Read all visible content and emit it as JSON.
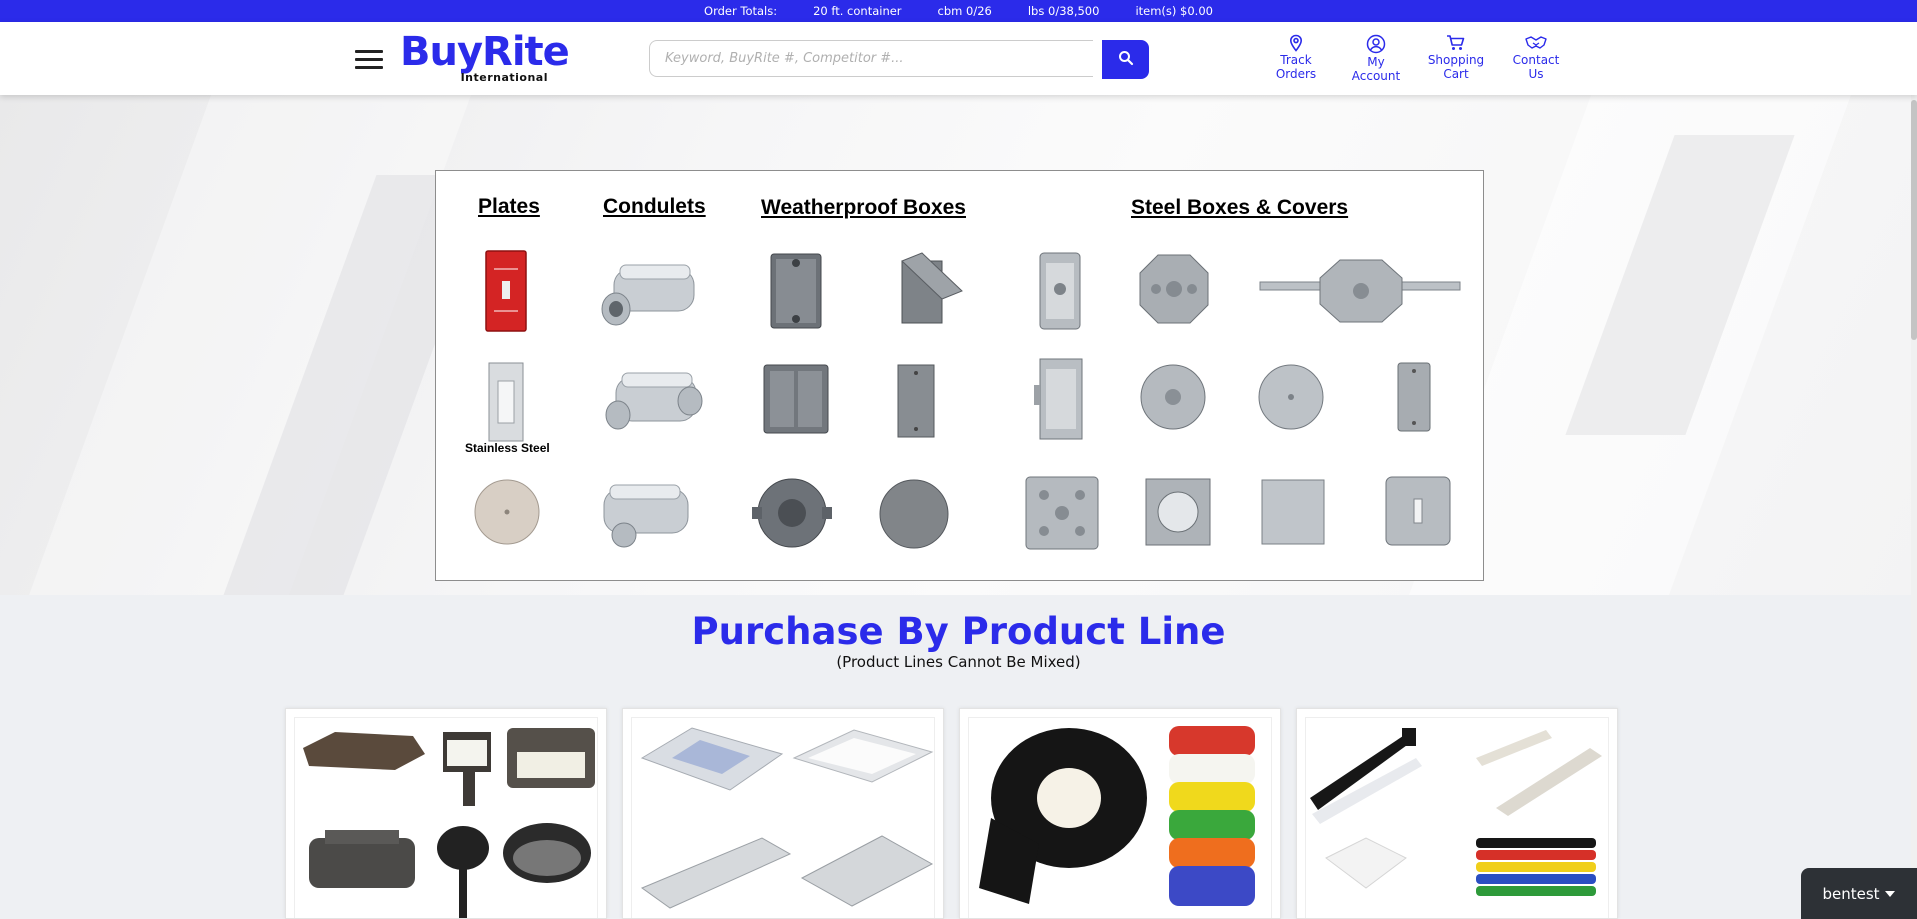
{
  "topbar": {
    "order_totals": "Order Totals:",
    "container": "20 ft. container",
    "cbm": "cbm 0/26",
    "lbs": "lbs 0/38,500",
    "items": "item(s) $0.00"
  },
  "header": {
    "logo_brand": "BuyRite",
    "logo_sub": "International",
    "search_placeholder": "Keyword, BuyRite #, Competitor #...",
    "nav": {
      "track": [
        "Track",
        "Orders"
      ],
      "account": [
        "My",
        "Account"
      ],
      "cart": [
        "Shopping",
        "Cart"
      ],
      "contact": [
        "Contact",
        "Us"
      ]
    }
  },
  "catalog": {
    "plates": "Plates",
    "condulets": "Condulets",
    "weatherproof": "Weatherproof Boxes",
    "steel": "Steel Boxes & Covers",
    "stainless_label": "Stainless Steel"
  },
  "product_lines": {
    "title": "Purchase By Product Line",
    "subtitle": "(Product Lines Cannot Be Mixed)"
  },
  "chat": {
    "label": "bentest"
  },
  "colors": {
    "brand_blue": "#2b2bea",
    "chat_bg": "#2d3136"
  }
}
